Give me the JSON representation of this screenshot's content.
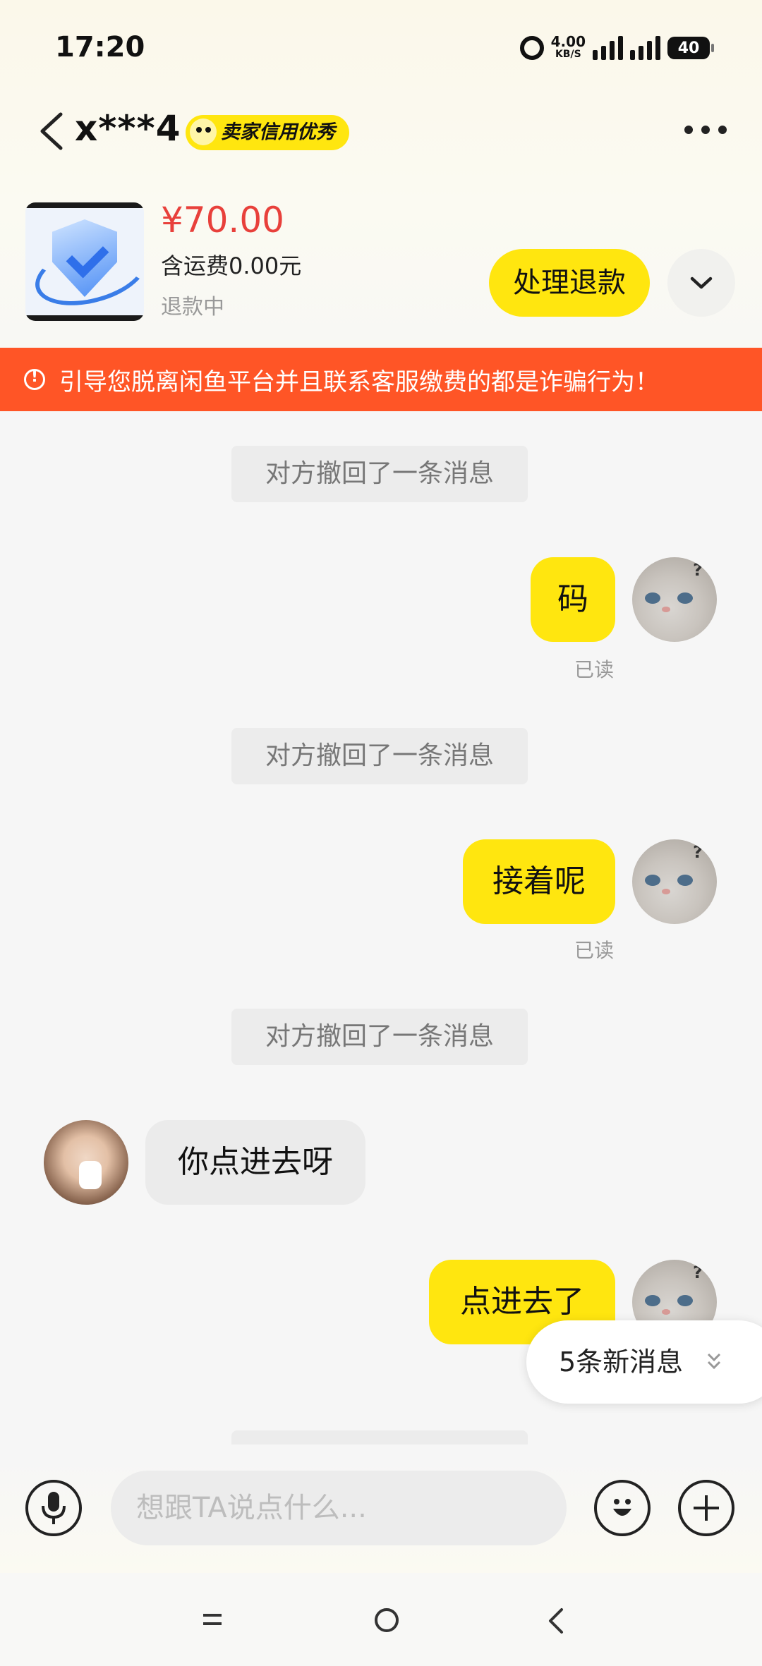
{
  "status_bar": {
    "time": "17:20",
    "net_speed": "4.00",
    "net_unit": "KB/S",
    "battery": "40"
  },
  "header": {
    "title": "x***4",
    "badge": "卖家信用优秀",
    "back_icon": "chevron-left-icon",
    "more_icon": "more-dots-icon"
  },
  "product": {
    "price": "¥70.00",
    "shipping": "含运费0.00元",
    "status": "退款中",
    "refund_button": "处理退款",
    "price_color": "#e8403b",
    "accent": "#ffe60f"
  },
  "warning": {
    "text": "引导您脱离闲鱼平台并且联系客服缴费的都是诈骗行为！",
    "color": "#ff5526"
  },
  "messages": [
    {
      "type": "system",
      "text": "对方撤回了一条消息"
    },
    {
      "type": "me",
      "text": "码",
      "read": "已读"
    },
    {
      "type": "system",
      "text": "对方撤回了一条消息"
    },
    {
      "type": "me",
      "text": "接着呢",
      "read": "已读"
    },
    {
      "type": "system",
      "text": "对方撤回了一条消息"
    },
    {
      "type": "other",
      "text": "你点进去呀"
    },
    {
      "type": "me",
      "text": "点进去了"
    }
  ],
  "new_messages": {
    "text": "5条新消息"
  },
  "composer": {
    "placeholder": "想跟TA说点什么..."
  }
}
